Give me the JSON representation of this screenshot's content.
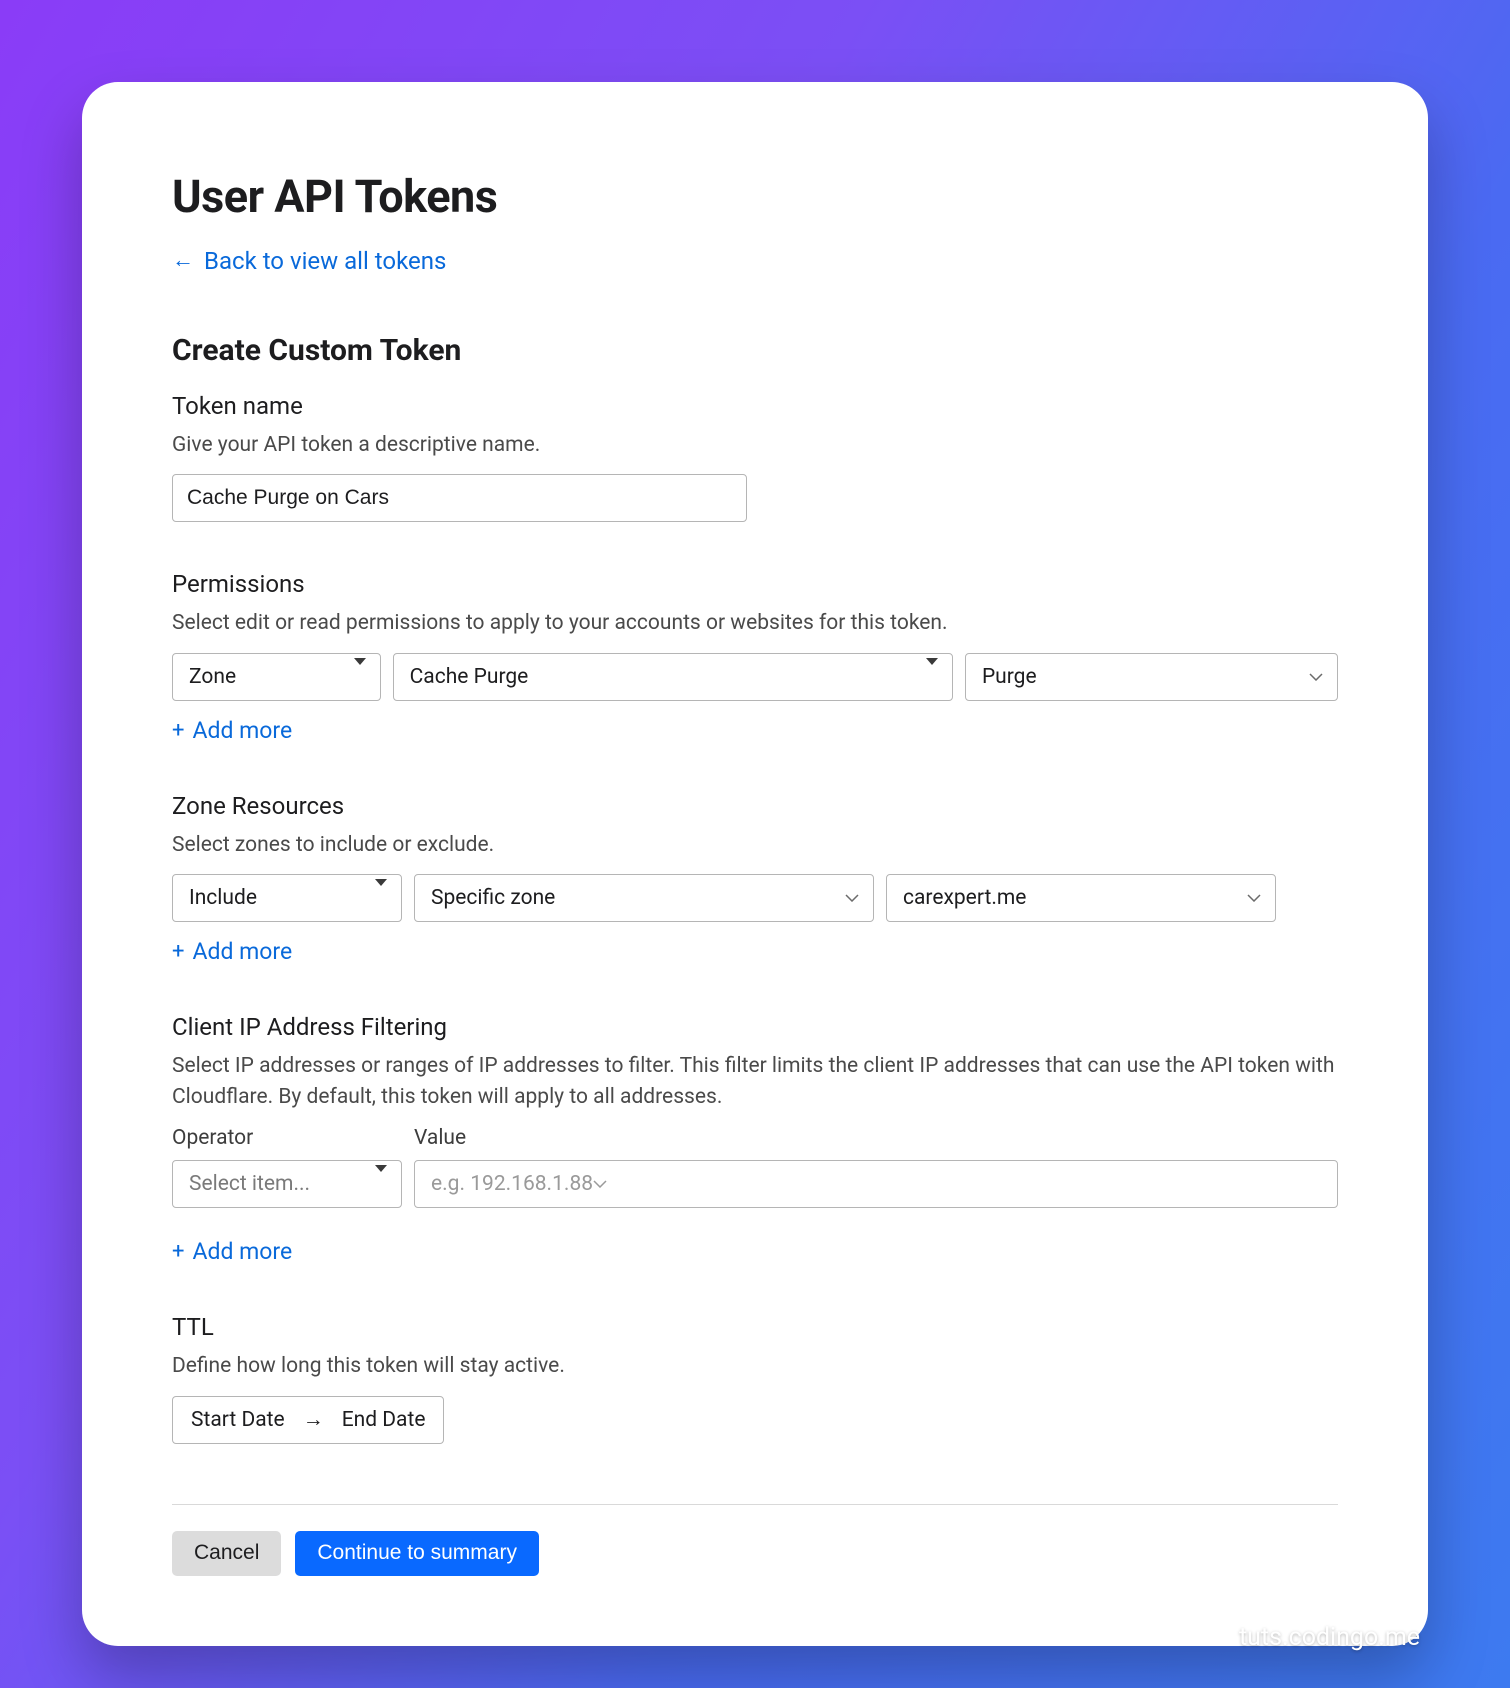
{
  "page_title": "User API Tokens",
  "back_link": "Back to view all tokens",
  "form_title": "Create Custom Token",
  "token_name": {
    "label": "Token name",
    "help": "Give your API token a descriptive name.",
    "value": "Cache Purge on Cars"
  },
  "permissions": {
    "label": "Permissions",
    "help": "Select edit or read permissions to apply to your accounts or websites for this token.",
    "scope": "Zone",
    "resource": "Cache Purge",
    "permission": "Purge",
    "add_more": "Add more"
  },
  "zone_resources": {
    "label": "Zone Resources",
    "help": "Select zones to include or exclude.",
    "mode": "Include",
    "selector": "Specific zone",
    "zone": "carexpert.me",
    "add_more": "Add more"
  },
  "ip_filter": {
    "label": "Client IP Address Filtering",
    "help": "Select IP addresses or ranges of IP addresses to filter. This filter limits the client IP addresses that can use the API token with Cloudflare. By default, this token will apply to all addresses.",
    "operator_label": "Operator",
    "value_label": "Value",
    "operator_placeholder": "Select item...",
    "value_placeholder": "e.g. 192.168.1.88",
    "add_more": "Add more"
  },
  "ttl": {
    "label": "TTL",
    "help": "Define how long this token will stay active.",
    "start": "Start Date",
    "end": "End Date"
  },
  "buttons": {
    "cancel": "Cancel",
    "continue": "Continue to summary"
  },
  "watermark": "tuts.codingo.me"
}
